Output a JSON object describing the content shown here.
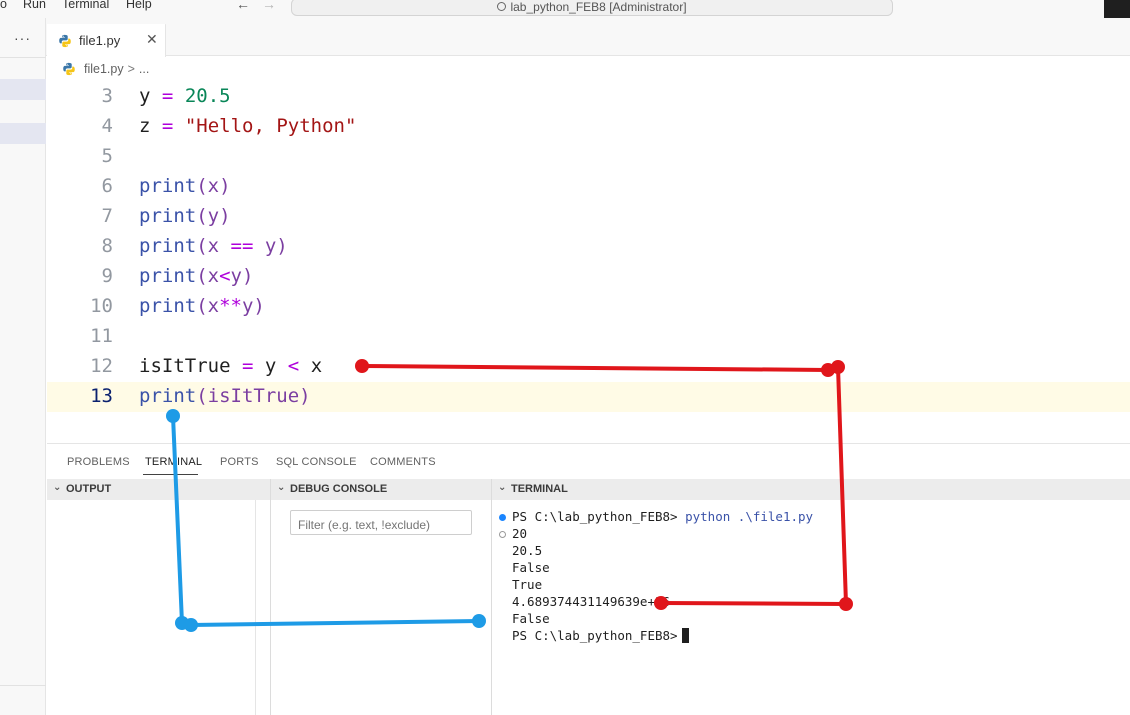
{
  "menu": {
    "item_partial": "o",
    "run": "Run",
    "terminal": "Terminal",
    "help": "Help"
  },
  "nav": {
    "back": "←",
    "forward": "→"
  },
  "command_center": {
    "title": "lab_python_FEB8 [Administrator]"
  },
  "activity": {
    "more": "···"
  },
  "tab": {
    "label": "file1.py",
    "close": "✕"
  },
  "breadcrumb": {
    "file": "file1.py",
    "separator": ">",
    "more": "..."
  },
  "editor": {
    "active_line": "13"
  },
  "panel": {
    "tabs": [
      "PROBLEMS",
      "TERMINAL",
      "PORTS",
      "SQL CONSOLE",
      "COMMENTS"
    ],
    "active_tab": "TERMINAL",
    "sections": {
      "output": "OUTPUT",
      "debug": "DEBUG CONSOLE",
      "terminal": "TERMINAL"
    },
    "debug_filter_placeholder": "Filter (e.g. text, !exclude)"
  },
  "terminal": {
    "prompt": "PS C:\\lab_python_FEB8>",
    "command": "python .\\file1.py",
    "output": [
      "20",
      "20.5",
      "False",
      "True",
      "4.689374431149639e+26",
      "False"
    ],
    "final_prompt": "PS C:\\lab_python_FEB8>"
  },
  "colors": {
    "annotation_red": "#e0161b",
    "annotation_blue": "#1e9be6",
    "current_line_bg": "#fffbe6"
  }
}
